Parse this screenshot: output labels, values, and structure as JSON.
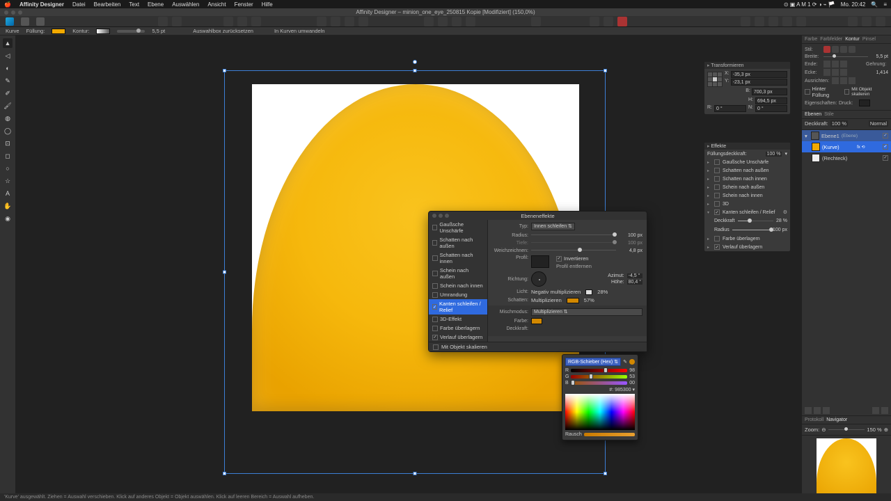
{
  "menubar": {
    "app": "Affinity Designer",
    "items": [
      "Datei",
      "Bearbeiten",
      "Text",
      "Ebene",
      "Auswählen",
      "Ansicht",
      "Fenster",
      "Hilfe"
    ],
    "clock": "Mo. 20:42"
  },
  "window_title": "Affinity Designer – minion_one_eye_250815 Kopie [Modifiziert] (150,0%)",
  "contextbar": {
    "curve_label": "Kurve",
    "fill_label": "Füllung:",
    "stroke_label": "Kontur:",
    "stroke_val": "5,5 pt",
    "reset_label": "Auswahlbox zurücksetzen",
    "convert_label": "In Kurven umwandeln"
  },
  "transform_panel": {
    "title": "Transformieren",
    "x_label": "X:",
    "x": "-35,3 px",
    "y_label": "Y:",
    "y": "-23,1 px",
    "w_label": "B:",
    "w": "700,3 px",
    "h_label": "H:",
    "h": "694,5 px",
    "r_label": "R:",
    "r": "0 °",
    "n_label": "N:",
    "n": "0 °"
  },
  "effects_panel": {
    "title": "Effekte",
    "opacity_label": "Füllungsdeckkraft:",
    "opacity": "100 %",
    "items": [
      {
        "label": "Gaußsche Unschärfe",
        "on": false,
        "expanded": false
      },
      {
        "label": "Schatten nach außen",
        "on": false,
        "expanded": false
      },
      {
        "label": "Schatten nach innen",
        "on": false,
        "expanded": false
      },
      {
        "label": "Schein nach außen",
        "on": false,
        "expanded": false
      },
      {
        "label": "Schein nach innen",
        "on": false,
        "expanded": false
      },
      {
        "label": "3D",
        "on": false,
        "expanded": false
      },
      {
        "label": "Kanten schleifen / Relief",
        "on": true,
        "expanded": true
      },
      {
        "label": "Farbe überlagern",
        "on": false,
        "expanded": false
      },
      {
        "label": "Verlauf überlagern",
        "on": true,
        "expanded": false
      }
    ],
    "bevel_detail": {
      "deck_label": "Deckkraft",
      "deck_val": "28 %",
      "radius_label": "Radius",
      "radius_val": "100 px"
    }
  },
  "dialog": {
    "title": "Ebeneneffekte",
    "list": [
      {
        "label": "Gaußsche Unschärfe",
        "on": false
      },
      {
        "label": "Schatten nach außen",
        "on": false
      },
      {
        "label": "Schatten nach innen",
        "on": false
      },
      {
        "label": "Schein nach außen",
        "on": false
      },
      {
        "label": "Schein nach innen",
        "on": false
      },
      {
        "label": "Umrandung",
        "on": false
      },
      {
        "label": "Kanten schleifen / Relief",
        "on": true,
        "sel": true
      },
      {
        "label": "3D-Effekt",
        "on": false
      },
      {
        "label": "Farbe überlagern",
        "on": false
      },
      {
        "label": "Verlauf überlagern",
        "on": true
      }
    ],
    "fields": {
      "type_label": "Typ:",
      "type_val": "Innen schleifen",
      "radius_label": "Radius:",
      "radius_val": "100 px",
      "depth_label": "Tiefe:",
      "depth_val": "100 px",
      "soften_label": "Weichzeichnen:",
      "soften_val": "4,8 px",
      "profile_label": "Profil:",
      "invert_label": "Invertieren",
      "remove_profile": "Profil entfernen",
      "direction_label": "Richtung:",
      "azimuth_label": "Azimut:",
      "azimuth_val": "-4,5 °",
      "height_label": "Höhe:",
      "height_val": "80,4 °",
      "light_label": "Licht:",
      "light_mode": "Negativ multiplizieren",
      "light_pct": "28%",
      "shadow_label": "Schatten:",
      "shadow_mode": "Multiplizieren",
      "shadow_pct": "57%",
      "blend_label": "Mischmodus:",
      "blend_val": "Multiplizieren",
      "color_label": "Farbe:",
      "opacity_label": "Deckkraft:"
    },
    "scale_checkbox": "Mit Objekt skalieren"
  },
  "color_popover": {
    "mode": "RGB-Schieber (Hex)",
    "r_label": "R",
    "r": "98",
    "g_label": "G",
    "g": "53",
    "b_label": "B",
    "b": "00",
    "hex_label": "#:",
    "hex": "985300",
    "noise_label": "Rausch"
  },
  "stroke_panel": {
    "tabs": [
      "Farbe",
      "Farbfelder",
      "Kontur",
      "Pinsel"
    ],
    "active_tab": "Kontur",
    "style_label": "Stil:",
    "width_label": "Breite:",
    "width_val": "5,5 pt",
    "cap_label": "Ende:",
    "join_label": "Gehrung:",
    "corner_label": "Ecke:",
    "miter_val": "1,414",
    "align_label": "Ausrichten:",
    "behind_fill": "Hinter Füllung",
    "scale_stroke": "Mit Objekt skalieren",
    "props_label": "Eigenschaften:",
    "pressure_label": "Druck:"
  },
  "layers_panel": {
    "tabs": [
      "Ebenen",
      "Stile"
    ],
    "opacity_label": "Deckkraft:",
    "opacity": "100 %",
    "blend": "Normal",
    "layers": [
      {
        "name": "Ebene1",
        "kind": "(Ebene)",
        "visible": true
      },
      {
        "name": "(Kurve)",
        "kind": "",
        "visible": true,
        "sel": true,
        "fx": true
      },
      {
        "name": "(Rechteck)",
        "kind": "",
        "visible": true
      }
    ]
  },
  "navigator": {
    "tabs": [
      "Protokoll",
      "Navigator"
    ],
    "zoom_label": "Zoom:",
    "zoom_val": "150 %"
  },
  "statusbar": "'Kurve' ausgewählt. Ziehen = Auswahl verschieben. Klick auf anderes Objekt = Objekt auswählen. Klick auf leeren Bereich = Auswahl aufheben."
}
